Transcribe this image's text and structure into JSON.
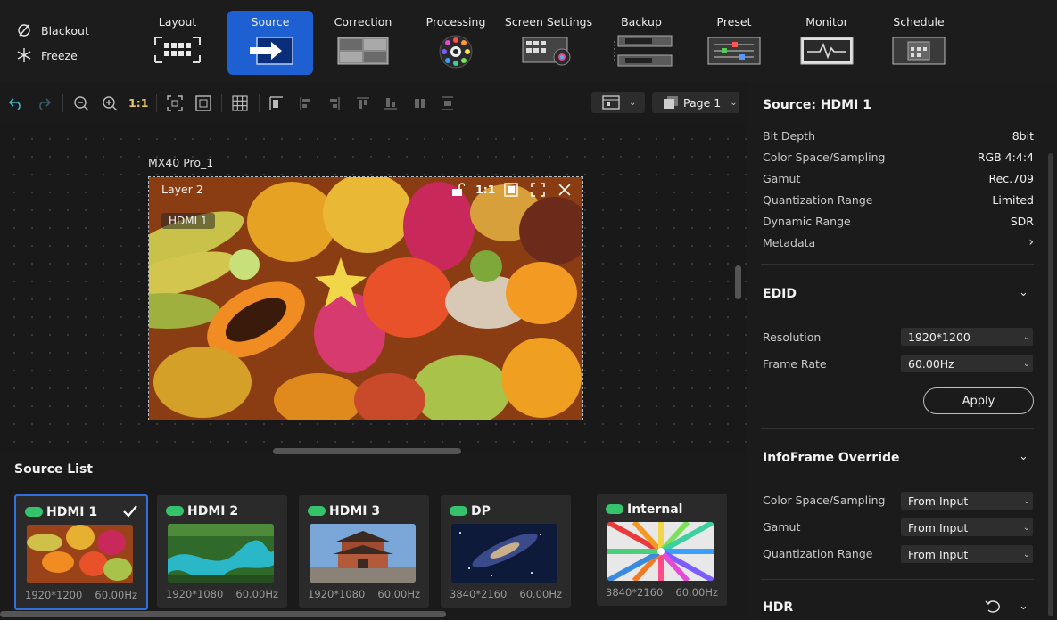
{
  "top_controls": {
    "blackout_label": "Blackout",
    "freeze_label": "Freeze"
  },
  "nav_tabs": [
    {
      "label": "Layout"
    },
    {
      "label": "Source"
    },
    {
      "label": "Correction"
    },
    {
      "label": "Processing"
    },
    {
      "label": "Screen Settings"
    },
    {
      "label": "Backup"
    },
    {
      "label": "Preset"
    },
    {
      "label": "Monitor"
    },
    {
      "label": "Schedule"
    }
  ],
  "toolbar": {
    "ratio_label": "1:1",
    "page_label": "Page 1"
  },
  "canvas": {
    "screen_name": "MX40 Pro_1",
    "layer_name": "Layer 2",
    "layer_source": "HDMI 1",
    "layer_ratio": "1:1"
  },
  "source_list": {
    "title": "Source List",
    "cards": [
      {
        "name": "HDMI 1",
        "resolution": "1920*1200",
        "rate": "60.00Hz",
        "selected": true
      },
      {
        "name": "HDMI 2",
        "resolution": "1920*1080",
        "rate": "60.00Hz"
      },
      {
        "name": "HDMI 3",
        "resolution": "1920*1080",
        "rate": "60.00Hz"
      },
      {
        "name": "DP",
        "resolution": "3840*2160",
        "rate": "60.00Hz"
      },
      {
        "name": "Internal",
        "resolution": "3840*2160",
        "rate": "60.00Hz"
      }
    ]
  },
  "right_panel": {
    "title": "Source: HDMI 1",
    "properties": [
      {
        "key": "Bit Depth",
        "value": "8bit"
      },
      {
        "key": "Color Space/Sampling",
        "value": "RGB 4:4:4"
      },
      {
        "key": "Gamut",
        "value": "Rec.709"
      },
      {
        "key": "Quantization Range",
        "value": "Limited"
      },
      {
        "key": "Dynamic Range",
        "value": "SDR"
      },
      {
        "key": "Metadata",
        "value": ""
      }
    ],
    "edid": {
      "title": "EDID",
      "resolution_label": "Resolution",
      "resolution_value": "1920*1200",
      "framerate_label": "Frame Rate",
      "framerate_value": "60.00Hz",
      "apply_label": "Apply"
    },
    "infoframe": {
      "title": "InfoFrame Override",
      "rows": [
        {
          "label": "Color Space/Sampling",
          "value": "From Input"
        },
        {
          "label": "Gamut",
          "value": "From Input"
        },
        {
          "label": "Quantization Range",
          "value": "From Input"
        }
      ]
    },
    "hdr": {
      "title": "HDR"
    }
  },
  "colors": {
    "accent": "#1e5fd1",
    "active_border": "#2f6fe0",
    "status_green": "#34c36a",
    "undo_teal": "#3fb7c9"
  }
}
